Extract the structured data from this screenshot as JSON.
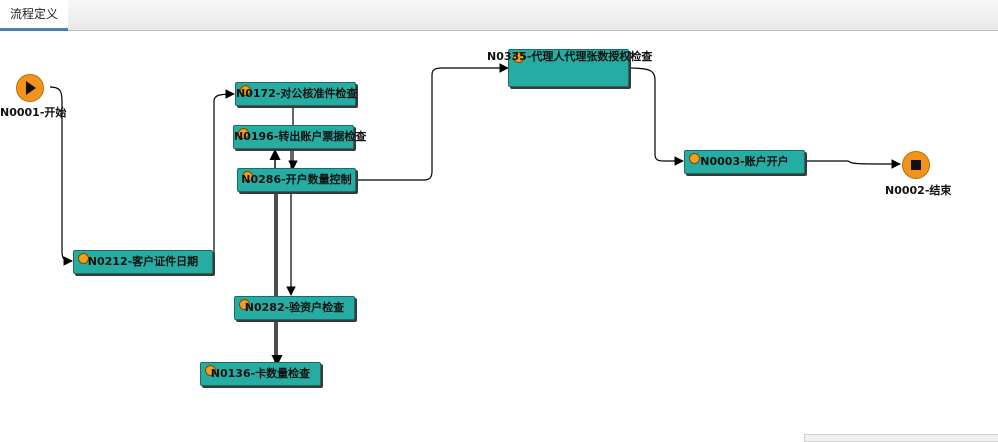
{
  "tab": {
    "label": "流程定义"
  },
  "events": {
    "start": {
      "label": "N0001-开始"
    },
    "end": {
      "label": "N0002-结束"
    }
  },
  "nodes": {
    "n0212": "N0212-客户证件日期",
    "n0172": "N0172-对公核准件检查",
    "n0196": "N0196-转出账户票据检查",
    "n0286": "N0286-开户数量控制",
    "n0282": "N0282-验资户检查",
    "n0136": "N0136-卡数量检查",
    "n0335": "N0335-代理人代理张数授权检查",
    "n0003": "N0003-账户开户"
  },
  "colors": {
    "task_fill": "#26ada3",
    "event_fill": "#f2931c",
    "edge": "#000000"
  }
}
